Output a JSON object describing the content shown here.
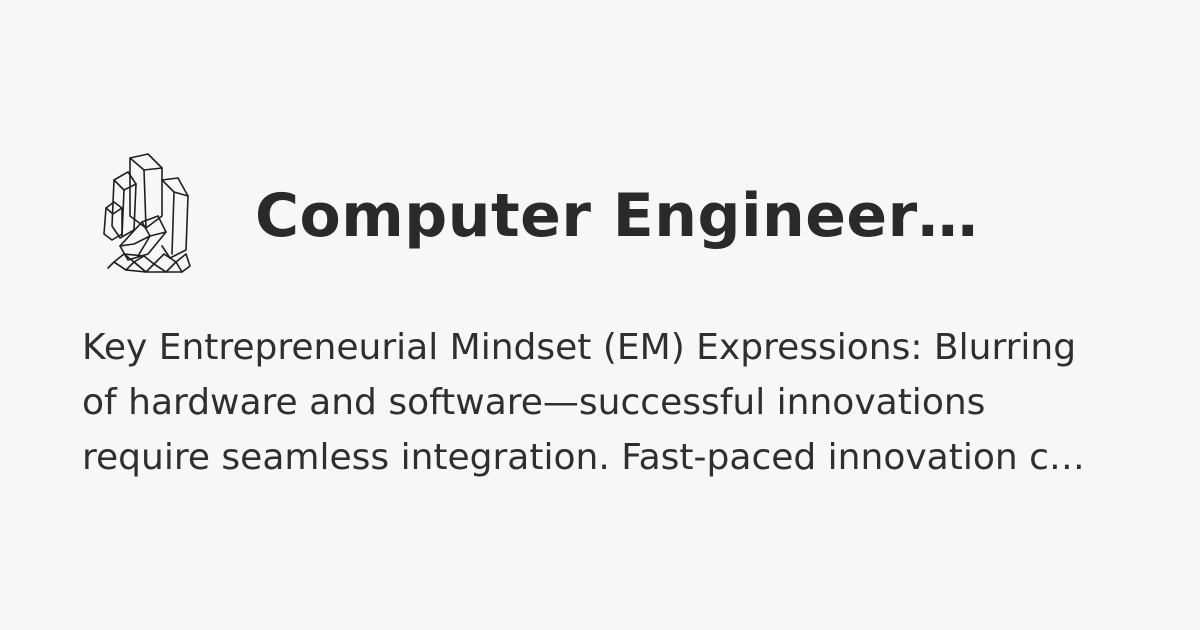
{
  "header": {
    "logo_icon": "crystal-cluster-icon",
    "title": "Computer Engineer…"
  },
  "description": {
    "lines": [
      "Key Entrepreneurial Mindset (EM) Expressions: Blurring",
      "of hardware and software—successful innovations",
      "require seamless integration. Fast-paced innovation c…"
    ]
  },
  "colors": {
    "background": "#f8f7f8",
    "text": "#2b2b2b",
    "icon_stroke": "#1f1f1f"
  }
}
